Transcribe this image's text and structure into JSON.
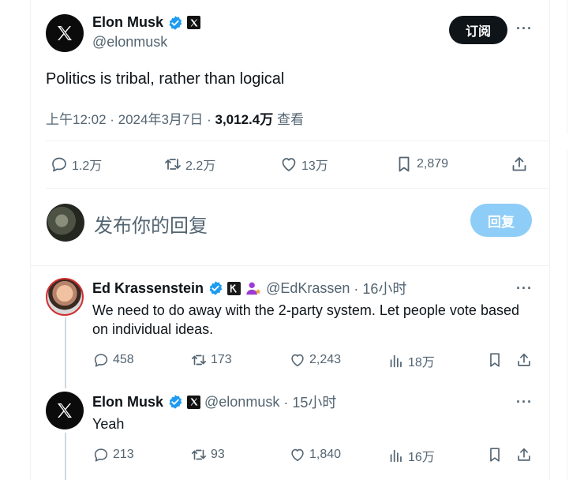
{
  "main_tweet": {
    "author_name": "Elon Musk",
    "author_handle": "@elonmusk",
    "subscribe_label": "订阅",
    "more_label": "···",
    "text": "Politics is tribal, rather than logical",
    "time": "上午12:02 · 2024年3月7日 · ",
    "views": "3,012.4万",
    "views_label": " 查看",
    "stats": {
      "replies": "1.2万",
      "retweets": "2.2万",
      "likes": "13万",
      "bookmarks": "2,879"
    }
  },
  "composer": {
    "placeholder": "发布你的回复",
    "reply_label": "回复"
  },
  "replies": [
    {
      "author_name": "Ed Krassenstein",
      "author_handle": "@EdKrassen",
      "time": " · 16小时",
      "text": "We need to do away with the 2-party system.  Let people vote based on individual ideas.",
      "stats": {
        "replies": "458",
        "retweets": "173",
        "likes": "2,243",
        "views": "18万"
      }
    },
    {
      "author_name": "Elon Musk",
      "author_handle": "@elonmusk",
      "time": " · 15小时",
      "text": "Yeah",
      "stats": {
        "replies": "213",
        "retweets": "93",
        "likes": "1,840",
        "views": "16万"
      }
    }
  ],
  "icons": {
    "verified": "verified-badge-icon",
    "x_logo": "x-logo-icon",
    "reply": "reply-icon",
    "retweet": "retweet-icon",
    "like": "heart-icon",
    "bookmark": "bookmark-icon",
    "share": "share-icon",
    "views": "views-chart-icon"
  },
  "colors": {
    "verified_blue": "#1d9bf0",
    "subscribe_bg": "#0f1419",
    "reply_button_bg": "#8ecdf7",
    "muted_text": "#536471"
  }
}
